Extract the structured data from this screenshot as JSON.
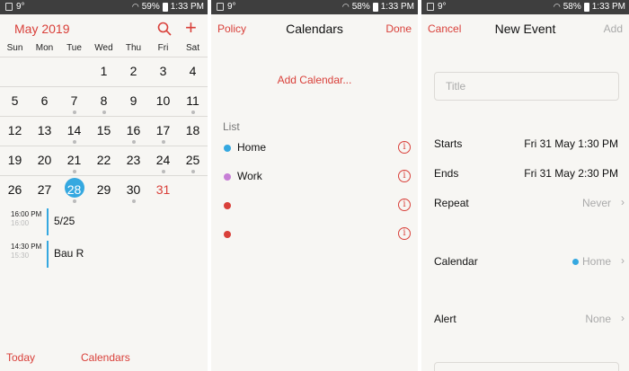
{
  "status": {
    "panel1": {
      "temp": "9°",
      "battery": "59%",
      "time": "1:33 PM"
    },
    "panel2": {
      "temp": "9°",
      "battery": "58%",
      "time": "1:33 PM"
    },
    "panel3": {
      "temp": "9°",
      "battery": "58%",
      "time": "1:33 PM"
    }
  },
  "calendar_view": {
    "month_title": "May 2019",
    "weekdays": [
      "Sun",
      "Mon",
      "Tue",
      "Wed",
      "Thu",
      "Fri",
      "Sat"
    ],
    "weeks": [
      [
        "",
        "",
        "",
        "1",
        "2",
        "3",
        "4"
      ],
      [
        "5",
        "6",
        "7",
        "8",
        "9",
        "10",
        "11"
      ],
      [
        "12",
        "13",
        "14",
        "15",
        "16",
        "17",
        "18"
      ],
      [
        "19",
        "20",
        "21",
        "22",
        "23",
        "24",
        "25"
      ],
      [
        "26",
        "27",
        "28",
        "29",
        "30",
        "31",
        ""
      ]
    ],
    "today": "28",
    "events": [
      {
        "time": "16:00 PM",
        "time_end": "16:00",
        "title": "5/25"
      },
      {
        "time": "14:30 PM",
        "time_end": "15:30",
        "title": "Bau R"
      }
    ],
    "bottom": {
      "today_label": "Today",
      "calendars_label": "Calendars"
    }
  },
  "calendars_view": {
    "left": "Policy",
    "title": "Calendars",
    "right": "Done",
    "add_calendar": "Add Calendar...",
    "list_header": "List",
    "items": [
      {
        "name": "Home",
        "color": "#35a8e0"
      },
      {
        "name": "Work",
        "color": "#c77fd6"
      },
      {
        "name": "",
        "color": "#d9403a"
      },
      {
        "name": "",
        "color": "#d9403a"
      }
    ],
    "info_glyph": "i"
  },
  "new_event_view": {
    "left": "Cancel",
    "title": "New Event",
    "right": "Add",
    "title_placeholder": "Title",
    "starts_label": "Starts",
    "starts_value": "Fri 31 May 1:30 PM",
    "ends_label": "Ends",
    "ends_value": "Fri 31 May 2:30 PM",
    "repeat_label": "Repeat",
    "repeat_value": "Never",
    "calendar_label": "Calendar",
    "calendar_value": "Home",
    "alert_label": "Alert",
    "alert_value": "None",
    "chevron": "›"
  },
  "colors": {
    "accent": "#d9403a",
    "today": "#35a8e0",
    "background": "#f7f6f3"
  }
}
